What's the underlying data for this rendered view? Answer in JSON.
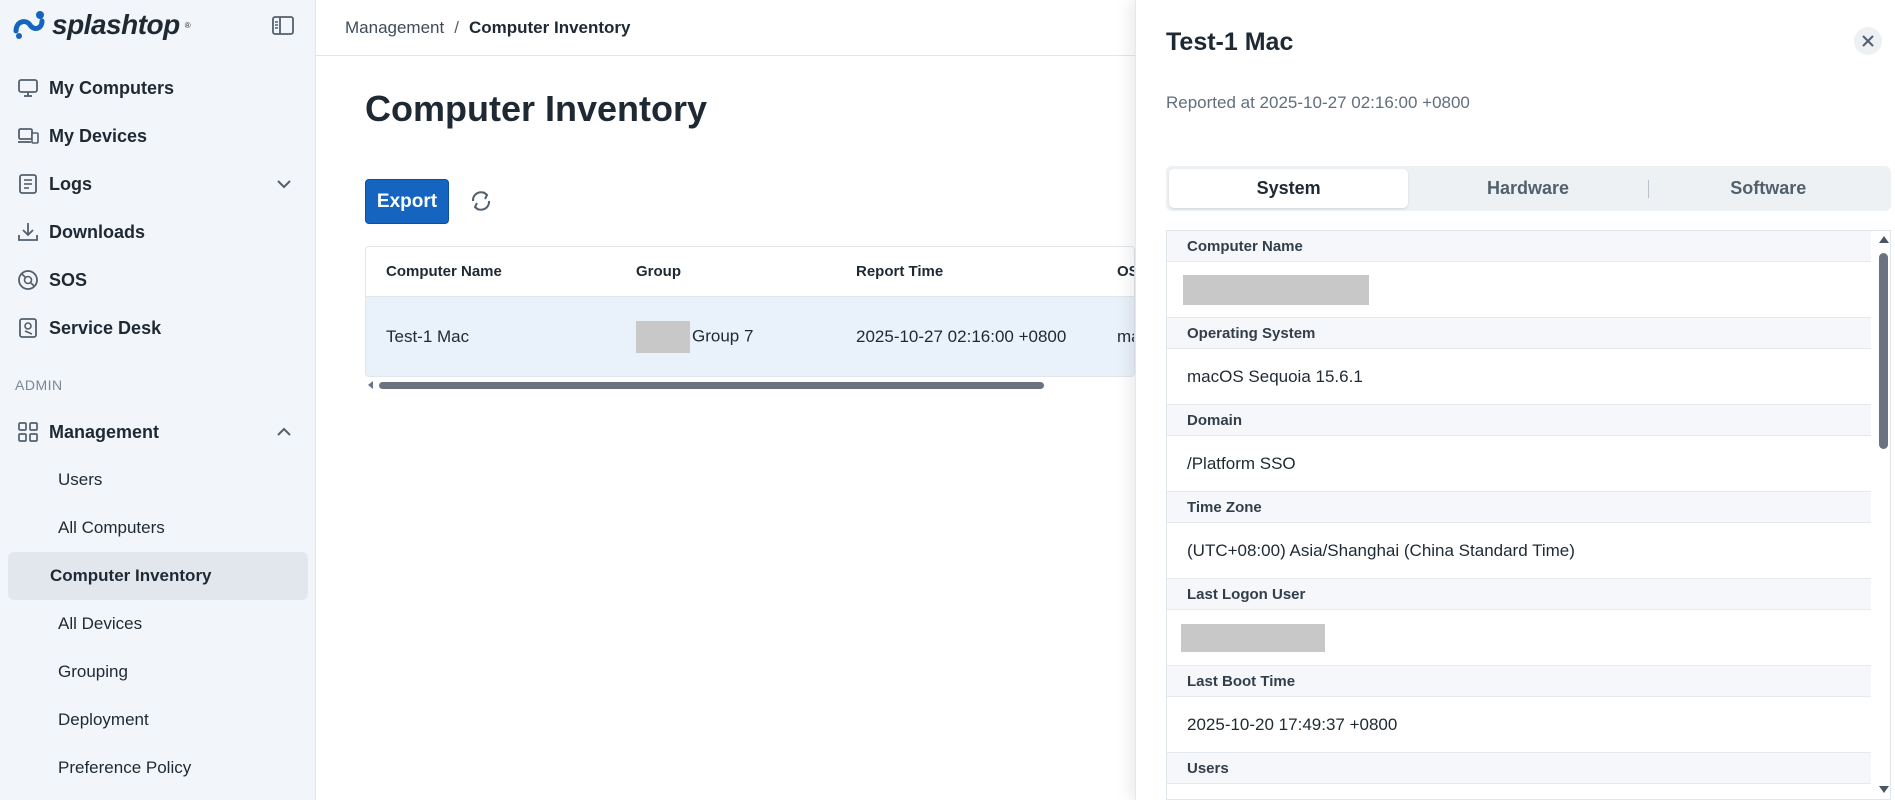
{
  "brand": {
    "name": "splashtop",
    "tm": "®",
    "accent": "#1565c0"
  },
  "sidebar": {
    "items": [
      {
        "label": "My Computers",
        "icon": "monitor-icon"
      },
      {
        "label": "My Devices",
        "icon": "devices-icon"
      },
      {
        "label": "Logs",
        "icon": "logs-icon",
        "expandable": true
      },
      {
        "label": "Downloads",
        "icon": "download-icon"
      },
      {
        "label": "SOS",
        "icon": "lifebuoy-icon"
      },
      {
        "label": "Service Desk",
        "icon": "service-desk-icon"
      }
    ],
    "section_admin": "ADMIN",
    "management": {
      "label": "Management",
      "icon": "grid-icon",
      "children": [
        "Users",
        "All Computers",
        "Computer Inventory",
        "All Devices",
        "Grouping",
        "Deployment",
        "Preference Policy"
      ],
      "active": "Computer Inventory"
    }
  },
  "breadcrumb": {
    "parent": "Management",
    "separator": "/",
    "current": "Computer Inventory"
  },
  "page": {
    "title": "Computer Inventory",
    "export_label": "Export"
  },
  "table": {
    "columns": [
      "Computer Name",
      "Group",
      "Report Time",
      "OS"
    ],
    "rows": [
      {
        "name": "Test-1 Mac",
        "group": "Group 7",
        "report_time": "2025-10-27 02:16:00 +0800",
        "os": "ma"
      }
    ]
  },
  "drawer": {
    "title": "Test-1 Mac",
    "reported": "Reported at 2025-10-27 02:16:00 +0800",
    "tabs": [
      "System",
      "Hardware",
      "Software"
    ],
    "active_tab": "System",
    "fields": {
      "computer_name_label": "Computer Name",
      "os_label": "Operating System",
      "os_value": "macOS Sequoia 15.6.1",
      "domain_label": "Domain",
      "domain_value": "/Platform SSO",
      "timezone_label": "Time Zone",
      "timezone_value": "(UTC+08:00) Asia/Shanghai (China Standard Time)",
      "last_logon_label": "Last Logon User",
      "last_boot_label": "Last Boot Time",
      "last_boot_value": "2025-10-20 17:49:37 +0800",
      "users_label": "Users"
    }
  }
}
